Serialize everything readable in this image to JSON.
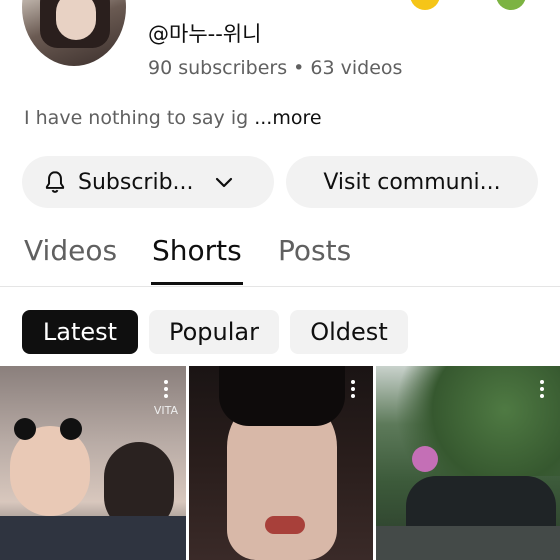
{
  "channel": {
    "handle": "@마누--위니",
    "stats": "90 subscribers • 63 videos",
    "bio": "I have nothing to say ig",
    "bio_more": "...more"
  },
  "actions": {
    "subscribe_label": "Subscrib...",
    "community_label": "Visit communi..."
  },
  "tabs": [
    {
      "label": "Videos",
      "active": false
    },
    {
      "label": "Shorts",
      "active": true
    },
    {
      "label": "Posts",
      "active": false
    }
  ],
  "filters": [
    {
      "label": "Latest",
      "active": true
    },
    {
      "label": "Popular",
      "active": false
    },
    {
      "label": "Oldest",
      "active": false
    }
  ],
  "shorts": [
    {
      "watermark": "VITA",
      "icon": "more-vert-icon"
    },
    {
      "watermark": "",
      "icon": "more-vert-icon"
    },
    {
      "watermark": "",
      "icon": "more-vert-icon"
    }
  ],
  "colors": {
    "text_primary": "#0f0f0f",
    "text_secondary": "#606060",
    "chip_bg": "#f2f2f2",
    "chip_active_bg": "#0f0f0f"
  }
}
